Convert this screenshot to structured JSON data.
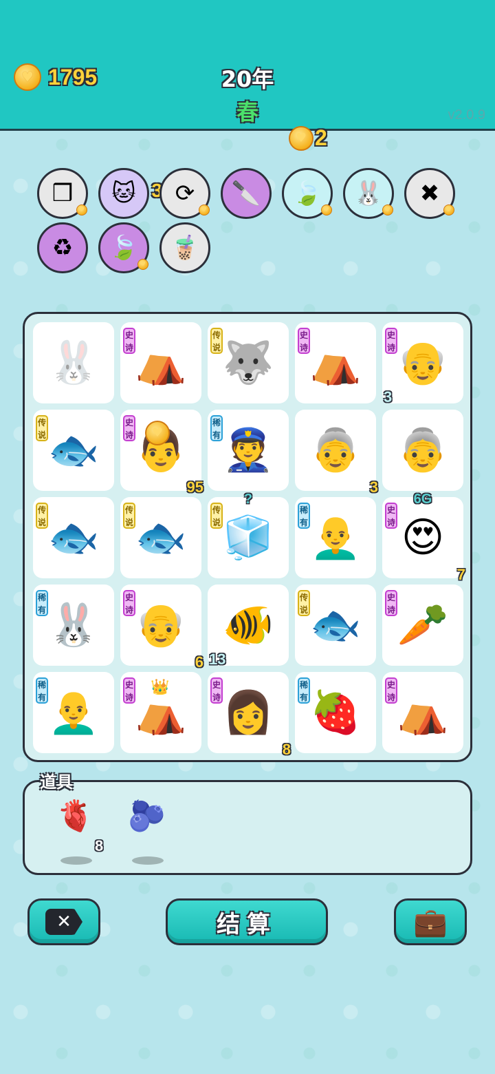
{
  "header": {
    "coins": "1795",
    "year": "20年",
    "season": "春",
    "version": "v2.0.9",
    "spin_cost": "2"
  },
  "skills": [
    {
      "name": "sugar-cubes",
      "icon": "❒",
      "bg": "#e8e8e8",
      "badge": true
    },
    {
      "name": "cat-coin",
      "icon": "🐱",
      "bg": "#d6c8f7",
      "count": "3",
      "badge": false
    },
    {
      "name": "refresh",
      "icon": "⟳",
      "bg": "#e8e8e8",
      "badge": true
    },
    {
      "name": "cleaver",
      "icon": "🔪",
      "bg": "#c98be3",
      "badge": false
    },
    {
      "name": "leaf",
      "icon": "🍃",
      "bg": "#c7f2f5",
      "badge": true
    },
    {
      "name": "rabbit",
      "icon": "🐰",
      "bg": "#c7f2f5",
      "badge": true
    },
    {
      "name": "delete-tag",
      "icon": "✖",
      "bg": "#e8e8e8",
      "badge": true
    },
    {
      "name": "recycle",
      "icon": "♻",
      "bg": "#c98be3",
      "badge": false
    },
    {
      "name": "leaf-2",
      "icon": "🍃",
      "bg": "#c98be3",
      "badge": true
    },
    {
      "name": "bubble-tea",
      "icon": "🧋",
      "bg": "#e8e8e8",
      "badge": false
    }
  ],
  "board": [
    [
      {
        "tag": "",
        "pic": "🐰",
        "count": "",
        "faded": true
      },
      {
        "tag": "史诗",
        "kind": "epic",
        "pic": "⛺",
        "count": ""
      },
      {
        "tag": "传说",
        "kind": "legend",
        "pic": "🐺",
        "count": ""
      },
      {
        "tag": "史诗",
        "kind": "epic",
        "pic": "⛺",
        "count": ""
      },
      {
        "tag": "史诗",
        "kind": "epic",
        "pic": "👴",
        "count": "3",
        "countLeft": true
      }
    ],
    [
      {
        "tag": "传说",
        "kind": "legend",
        "pic": "🐟",
        "count": ""
      },
      {
        "tag": "史诗",
        "kind": "epic",
        "pic": "👨",
        "count": "95",
        "coin": true
      },
      {
        "tag": "稀有",
        "kind": "rare",
        "pic": "👮",
        "count": ""
      },
      {
        "tag": "",
        "pic": "👵",
        "count": "3"
      },
      {
        "tag": "",
        "pic": "👵",
        "count": ""
      }
    ],
    [
      {
        "tag": "传说",
        "kind": "legend",
        "pic": "🐟",
        "count": ""
      },
      {
        "tag": "传说",
        "kind": "legend",
        "pic": "🐟",
        "count": ""
      },
      {
        "tag": "传说",
        "kind": "legend",
        "pic": "🧊",
        "count": "",
        "note": "?"
      },
      {
        "tag": "稀有",
        "kind": "rare",
        "pic": "👨‍🦲",
        "count": ""
      },
      {
        "tag": "史诗",
        "kind": "epic",
        "pic": "😍",
        "count": "7",
        "note": "6G"
      }
    ],
    [
      {
        "tag": "稀有",
        "kind": "rare",
        "pic": "🐰",
        "count": ""
      },
      {
        "tag": "史诗",
        "kind": "epic",
        "pic": "👴",
        "count": "6"
      },
      {
        "tag": "",
        "pic": "🐠",
        "count": "13",
        "countLeft": true
      },
      {
        "tag": "传说",
        "kind": "legend",
        "pic": "🐟",
        "count": ""
      },
      {
        "tag": "史诗",
        "kind": "epic",
        "pic": "🥕",
        "count": ""
      }
    ],
    [
      {
        "tag": "稀有",
        "kind": "rare",
        "pic": "👨‍🦲",
        "count": ""
      },
      {
        "tag": "史诗",
        "kind": "epic",
        "pic": "⛺",
        "count": "",
        "crown": true
      },
      {
        "tag": "史诗",
        "kind": "epic",
        "pic": "👩",
        "count": "8"
      },
      {
        "tag": "稀有",
        "kind": "rare",
        "pic": "🍓",
        "count": ""
      },
      {
        "tag": "史诗",
        "kind": "epic",
        "pic": "⛺",
        "count": ""
      }
    ]
  ],
  "items": {
    "title": "道具",
    "list": [
      {
        "name": "liver",
        "pic": "🫀",
        "count": "8"
      },
      {
        "name": "blueberry",
        "pic": "🫐",
        "count": ""
      }
    ]
  },
  "buttons": {
    "settle_label": "结算"
  }
}
